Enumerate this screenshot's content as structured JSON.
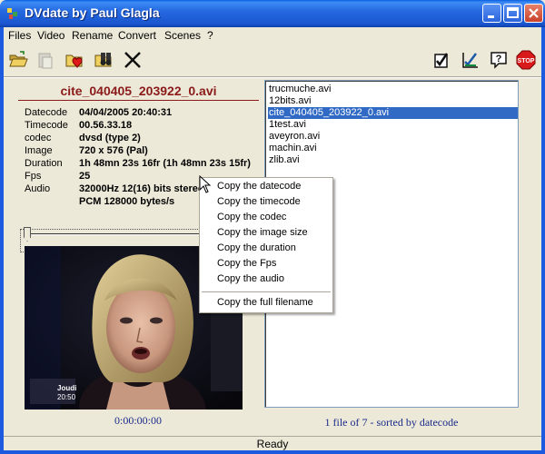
{
  "window": {
    "title": "DVdate by Paul Glagla"
  },
  "menu": [
    "Files",
    "Video",
    "Rename",
    "Convert",
    "Scenes",
    "?"
  ],
  "toolbar": {
    "icons": [
      "open-folder-icon",
      "paste-icon",
      "folder-heart-icon",
      "binoculars-icon",
      "cross-tool-icon",
      "checklist-icon",
      "chart-check-icon",
      "help-icon",
      "stop-icon"
    ]
  },
  "info": {
    "file_title": "cite_040405_203922_0.avi",
    "rows": [
      {
        "label": "Datecode",
        "value": "04/04/2005 20:40:31"
      },
      {
        "label": "Timecode",
        "value": "00.56.33.18"
      },
      {
        "label": "codec",
        "value": "dvsd (type 2)"
      },
      {
        "label": "Image",
        "value": "720 x 576 (Pal)"
      },
      {
        "label": "Duration",
        "value": "1h 48mn 23s 16fr (1h 48mn 23s 15fr)"
      },
      {
        "label": "Fps",
        "value": "25"
      },
      {
        "label": "Audio",
        "value": "32000Hz 12(16) bits  stereo"
      },
      {
        "label": "",
        "value": "PCM 128000 bytes/s"
      }
    ]
  },
  "video": {
    "overlay_title": "Joudi",
    "overlay_time": "20:50",
    "time": "0:00:00:00"
  },
  "filelist": {
    "files": [
      "trucmuche.avi",
      "12bits.avi",
      "cite_040405_203922_0.avi",
      "1test.avi",
      "aveyron.avi",
      "machin.avi",
      "zlib.avi"
    ],
    "selected_index": 2,
    "summary": "1 file of 7 - sorted by datecode"
  },
  "context_menu": {
    "items": [
      "Copy the datecode",
      "Copy the timecode",
      "Copy the codec",
      "Copy the image size",
      "Copy the duration",
      "Copy the Fps",
      "Copy the audio"
    ],
    "extra": "Copy the full filename"
  },
  "status": "Ready"
}
